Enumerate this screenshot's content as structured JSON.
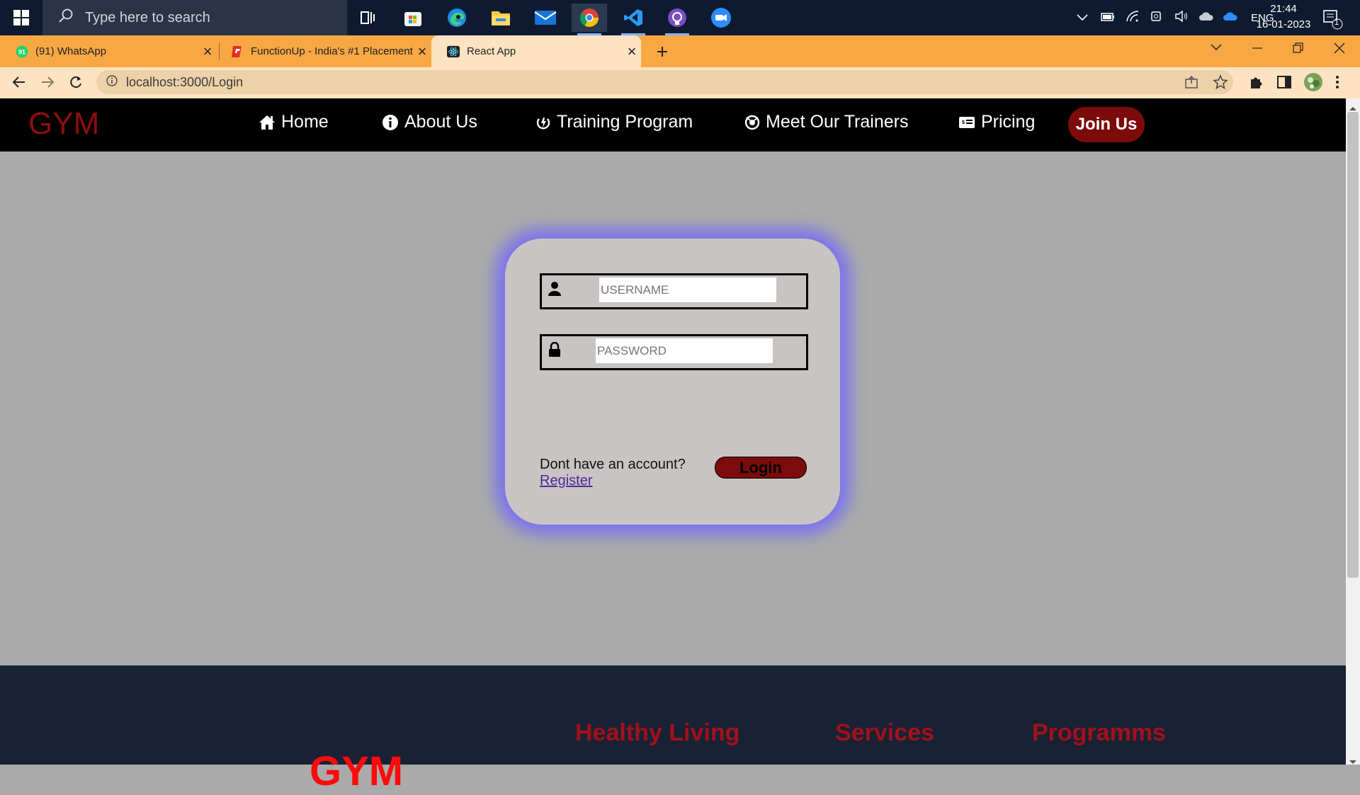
{
  "taskbar": {
    "search_placeholder": "Type here to search",
    "apps": [
      "task-view",
      "microsoft-store",
      "edge",
      "file-explorer",
      "mail",
      "chrome",
      "vscode",
      "github-desktop",
      "zoom"
    ],
    "tray": {
      "language": "ENG",
      "time": "21:44",
      "date": "16-01-2023",
      "notification_count": "1"
    }
  },
  "browser": {
    "tabs": [
      {
        "title": "(91) WhatsApp",
        "badge": "91"
      },
      {
        "title": "FunctionUp - India's #1 Placement"
      },
      {
        "title": "React App"
      }
    ],
    "url": "localhost:3000/Login"
  },
  "site": {
    "logo": "GYM",
    "nav": [
      "Home",
      "About Us",
      "Training Program",
      "Meet Our Trainers",
      "Pricing"
    ],
    "join_label": "Join Us",
    "accent": "#7c0b0b"
  },
  "login": {
    "username_placeholder": "USERNAME",
    "password_placeholder": "PASSWORD",
    "no_account_text": "Dont have an account?",
    "register_label": "Register",
    "login_label": "Login",
    "glow_color": "#7a72ee"
  },
  "footer": {
    "logo": "GYM",
    "headings": [
      "Healthy Living",
      "Services",
      "Programms"
    ]
  }
}
